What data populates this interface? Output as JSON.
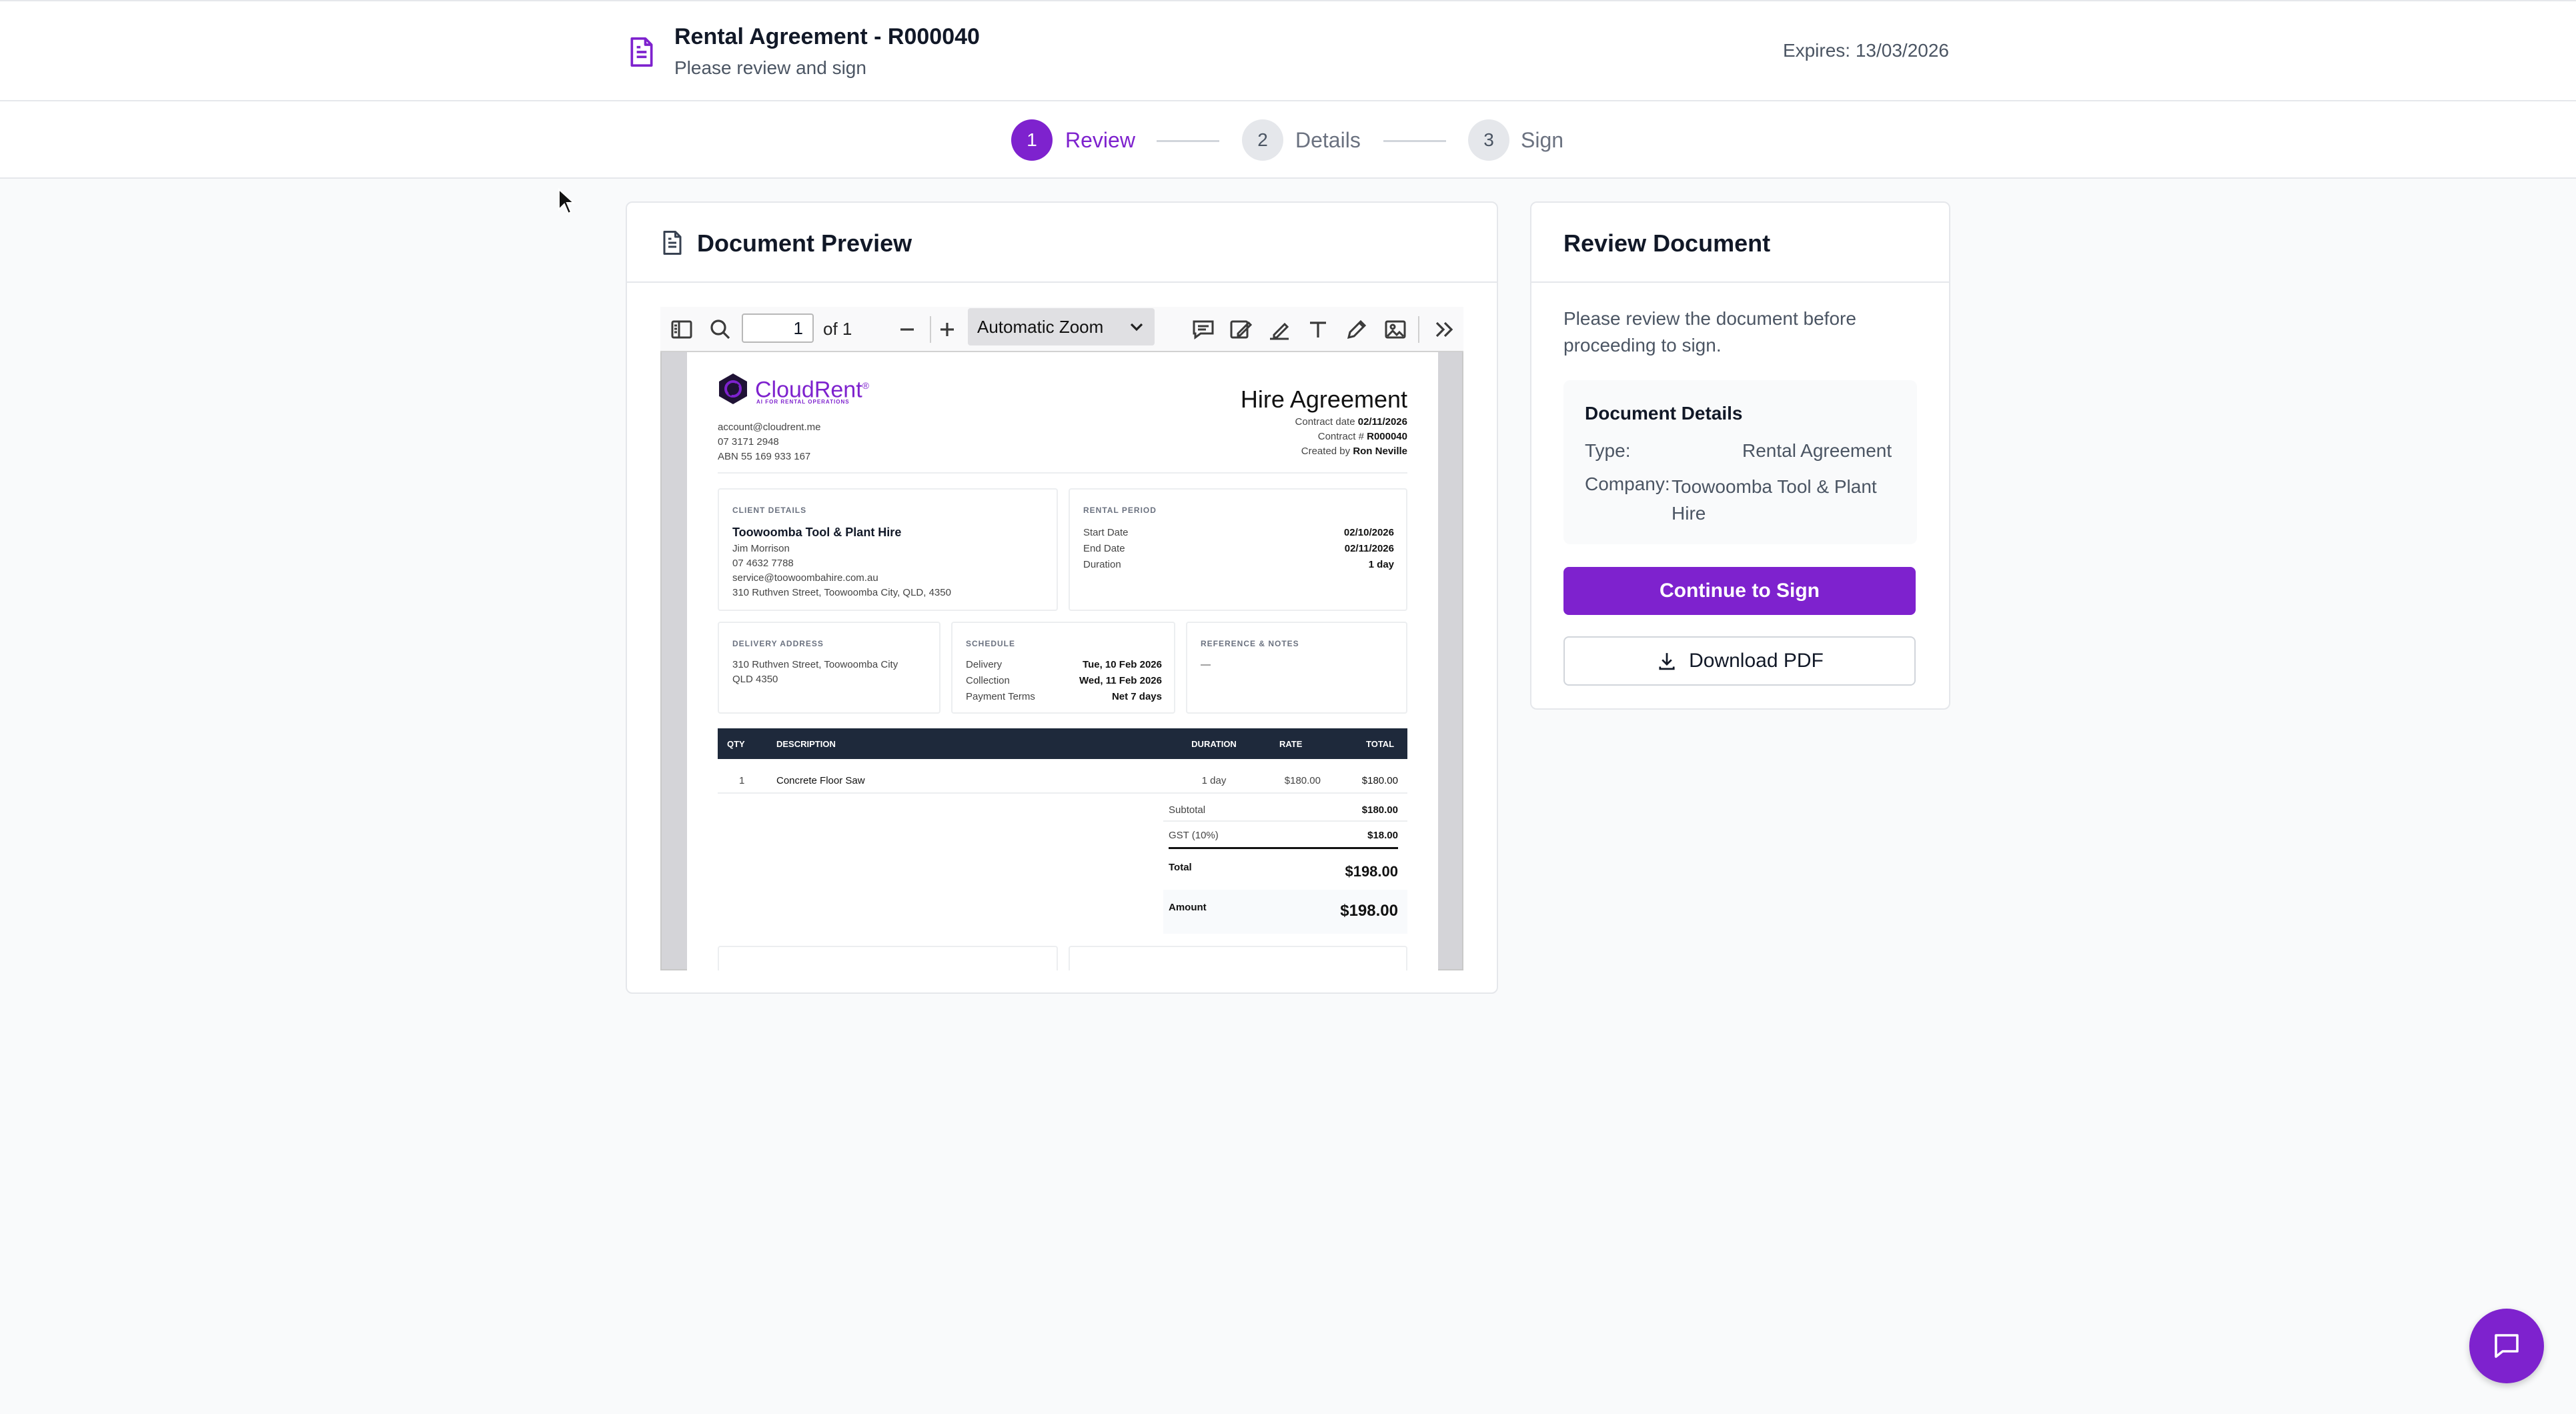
{
  "header": {
    "title": "Rental Agreement - R000040",
    "subtitle": "Please review and sign",
    "expires": "Expires: 13/03/2026",
    "icon": "document-icon"
  },
  "stepper": [
    {
      "number": "1",
      "label": "Review",
      "active": true
    },
    {
      "number": "2",
      "label": "Details",
      "active": false
    },
    {
      "number": "3",
      "label": "Sign",
      "active": false
    }
  ],
  "preview": {
    "title": "Document Preview",
    "toolbar": {
      "page_value": "1",
      "page_of": "of 1",
      "zoom": "Automatic Zoom"
    },
    "document": {
      "brand": "CloudRent",
      "brand_mark": "®",
      "brand_tagline": "AI FOR RENTAL OPERATIONS",
      "email": "account@cloudrent.me",
      "phone": "07 3171 2948",
      "abn": "ABN 55 169 933 167",
      "heading": "Hire Agreement",
      "contract_date_label": "Contract date",
      "contract_date": "02/11/2026",
      "contract_no_label": "Contract #",
      "contract_no": "R000040",
      "created_by_label": "Created by",
      "created_by": "Ron Neville",
      "client_label": "CLIENT DETAILS",
      "client_name": "Toowoomba Tool & Plant Hire",
      "client_contact": "Jim Morrison",
      "client_phone": "07 4632 7788",
      "client_email": "service@toowoombahire.com.au",
      "client_address": "310 Ruthven Street, Toowoomba City, QLD, 4350",
      "period_label": "RENTAL PERIOD",
      "start_label": "Start Date",
      "start": "02/10/2026",
      "end_label": "End Date",
      "end": "02/11/2026",
      "duration_label": "Duration",
      "duration": "1 day",
      "delivery_label": "DELIVERY ADDRESS",
      "delivery_line1": "310 Ruthven Street, Toowoomba City",
      "delivery_line2": "QLD 4350",
      "schedule_label": "SCHEDULE",
      "sched_delivery_label": "Delivery",
      "sched_delivery": "Tue, 10 Feb 2026",
      "sched_collection_label": "Collection",
      "sched_collection": "Wed, 11 Feb 2026",
      "sched_terms_label": "Payment Terms",
      "sched_terms": "Net 7 days",
      "ref_label": "REFERENCE & NOTES",
      "ref_value": "—",
      "table_headers": [
        "QTY",
        "DESCRIPTION",
        "DURATION",
        "RATE",
        "TOTAL"
      ],
      "row": {
        "qty": "1",
        "description": "Concrete Floor Saw",
        "duration": "1 day",
        "rate": "$180.00",
        "total": "$180.00"
      },
      "subtotal_label": "Subtotal",
      "subtotal": "$180.00",
      "gst_label": "GST (10%)",
      "gst": "$18.00",
      "total_label": "Total",
      "total": "$198.00",
      "amount_label": "Amount",
      "amount": "$198.00"
    }
  },
  "review": {
    "title": "Review Document",
    "text": "Please review the document before proceeding to sign.",
    "details_title": "Document Details",
    "type_label": "Type:",
    "type_value": "Rental Agreement",
    "company_label": "Company:",
    "company_value": "Toowoomba Tool & Plant Hire",
    "continue_label": "Continue to Sign",
    "download_label": "Download PDF"
  },
  "colors": {
    "accent": "#7e22ce",
    "background": "#f9fafb",
    "doc_table_header": "#1e293b"
  }
}
